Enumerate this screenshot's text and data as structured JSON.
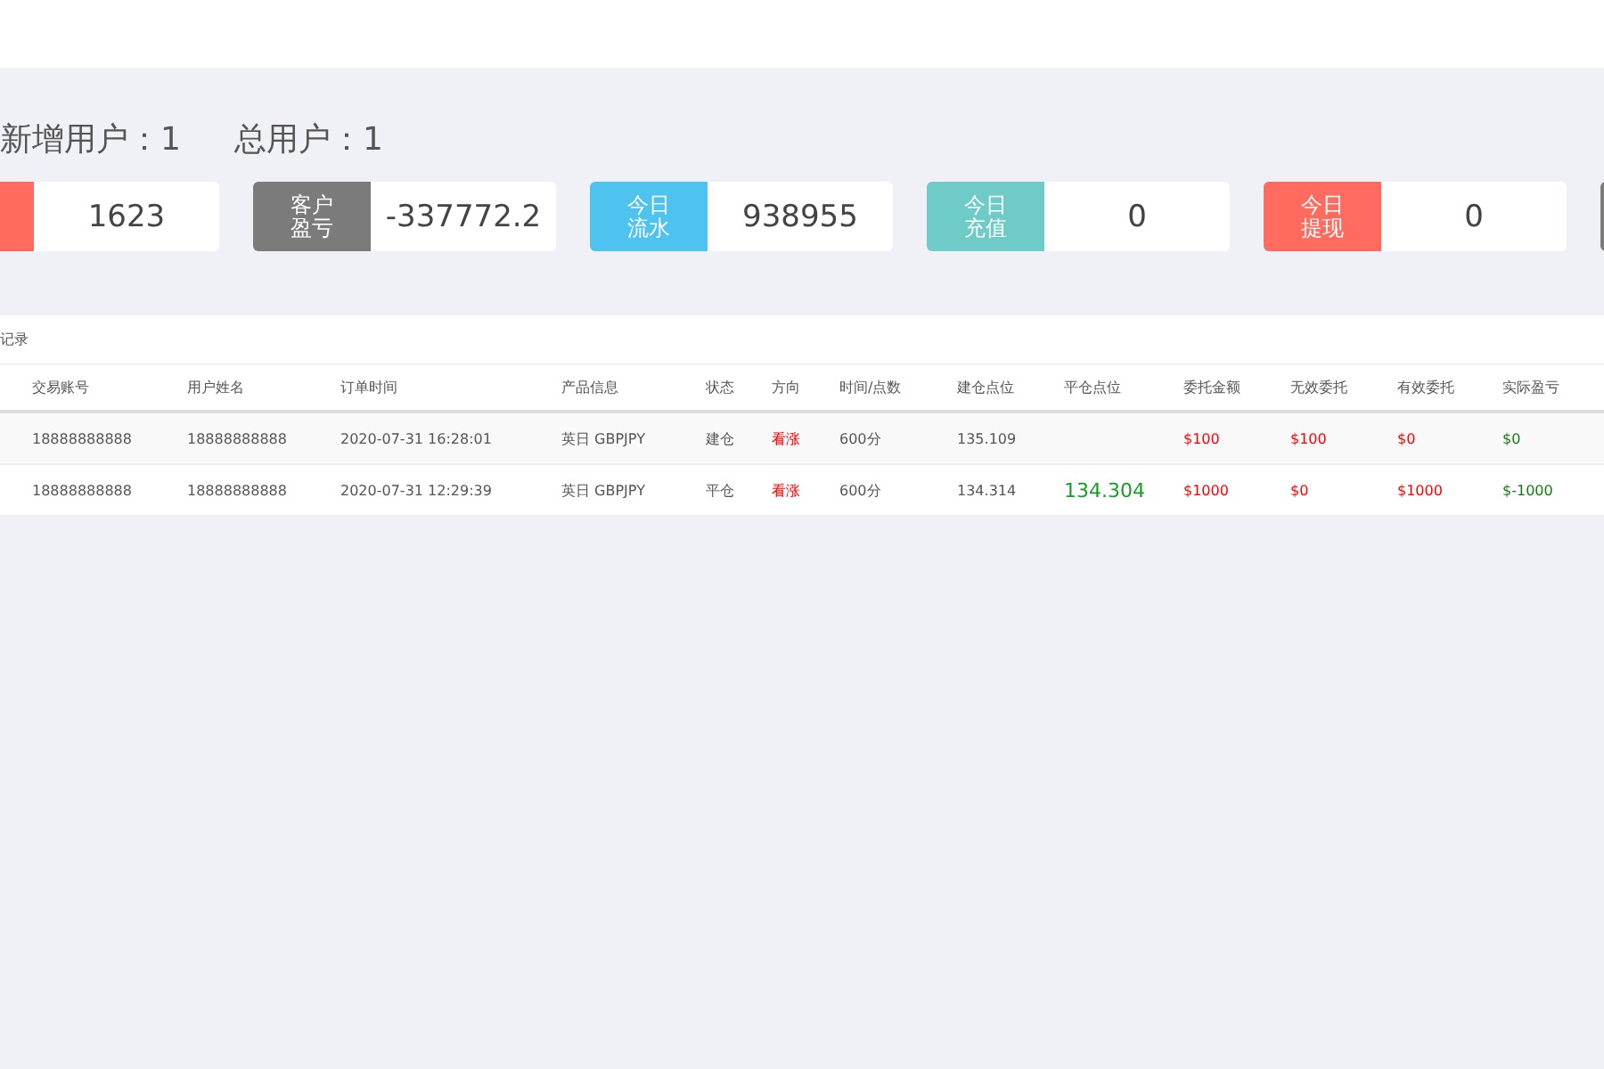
{
  "stats": [
    {
      "label": "新增用户：",
      "value": "1"
    },
    {
      "label": "总用户：",
      "value": "1"
    }
  ],
  "cards": [
    {
      "value": "1623",
      "color": "#ff6b5f"
    },
    {
      "lines": [
        "客户",
        "盈亏"
      ],
      "value": "-337772.2",
      "color": "#7b7b7b"
    },
    {
      "lines": [
        "今日",
        "流水"
      ],
      "value": "938955",
      "color": "#4fc3ef"
    },
    {
      "lines": [
        "今日",
        "充值"
      ],
      "value": "0",
      "color": "#6ecbc8"
    },
    {
      "lines": [
        "今日",
        "提现"
      ],
      "value": "0",
      "color": "#ff6b5f"
    },
    {
      "color": "#7b7b7b"
    }
  ],
  "table": {
    "title": "记录",
    "columns": [
      "交易账号",
      "用户姓名",
      "订单时间",
      "产品信息",
      "状态",
      "方向",
      "时间/点数",
      "建仓点位",
      "平仓点位",
      "委托金额",
      "无效委托",
      "有效委托",
      "实际盈亏"
    ],
    "rows": [
      [
        "18888888888",
        "18888888888",
        "2020-07-31 16:28:01",
        "英日 GBPJPY",
        "建仓",
        "看涨",
        "600分",
        "135.109",
        "",
        "$100",
        "$100",
        "$0",
        "$0"
      ],
      [
        "18888888888",
        "18888888888",
        "2020-07-31 12:29:39",
        "英日 GBPJPY",
        "平仓",
        "看涨",
        "600分",
        "134.314",
        "134.304",
        "$1000",
        "$0",
        "$1000",
        "$-1000"
      ]
    ]
  }
}
